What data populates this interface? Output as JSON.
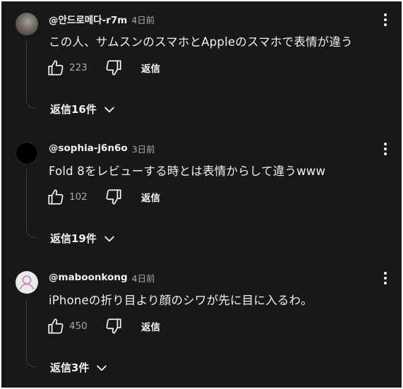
{
  "comments": [
    {
      "author": "@안드로메다-r7m",
      "time": "4日前",
      "text": "この人、サムスンのスマホとAppleのスマホで表情が違う",
      "likes": "223",
      "reply_label": "返信",
      "replies_label": "返信16件",
      "avatar": "photo-avatar"
    },
    {
      "author": "@sophia-j6n6o",
      "time": "3日前",
      "text": "Fold 8をレビューする時とは表情からして違うwww",
      "likes": "102",
      "reply_label": "返信",
      "replies_label": "返信19件",
      "avatar": "black-avatar"
    },
    {
      "author": "@maboonkong",
      "time": "4日前",
      "text": "iPhoneの折り目より顔のシワが先に目に入るわ。",
      "likes": "450",
      "reply_label": "返信",
      "replies_label": "返信3件",
      "avatar": "default-person-avatar"
    }
  ],
  "icons": {
    "like": "thumbs-up-icon",
    "dislike": "thumbs-down-icon",
    "more": "more-vert-icon",
    "expand": "chevron-down-icon"
  },
  "colors": {
    "background": "#181818",
    "text": "#f1f1f1",
    "secondary": "#aaaaaa"
  }
}
